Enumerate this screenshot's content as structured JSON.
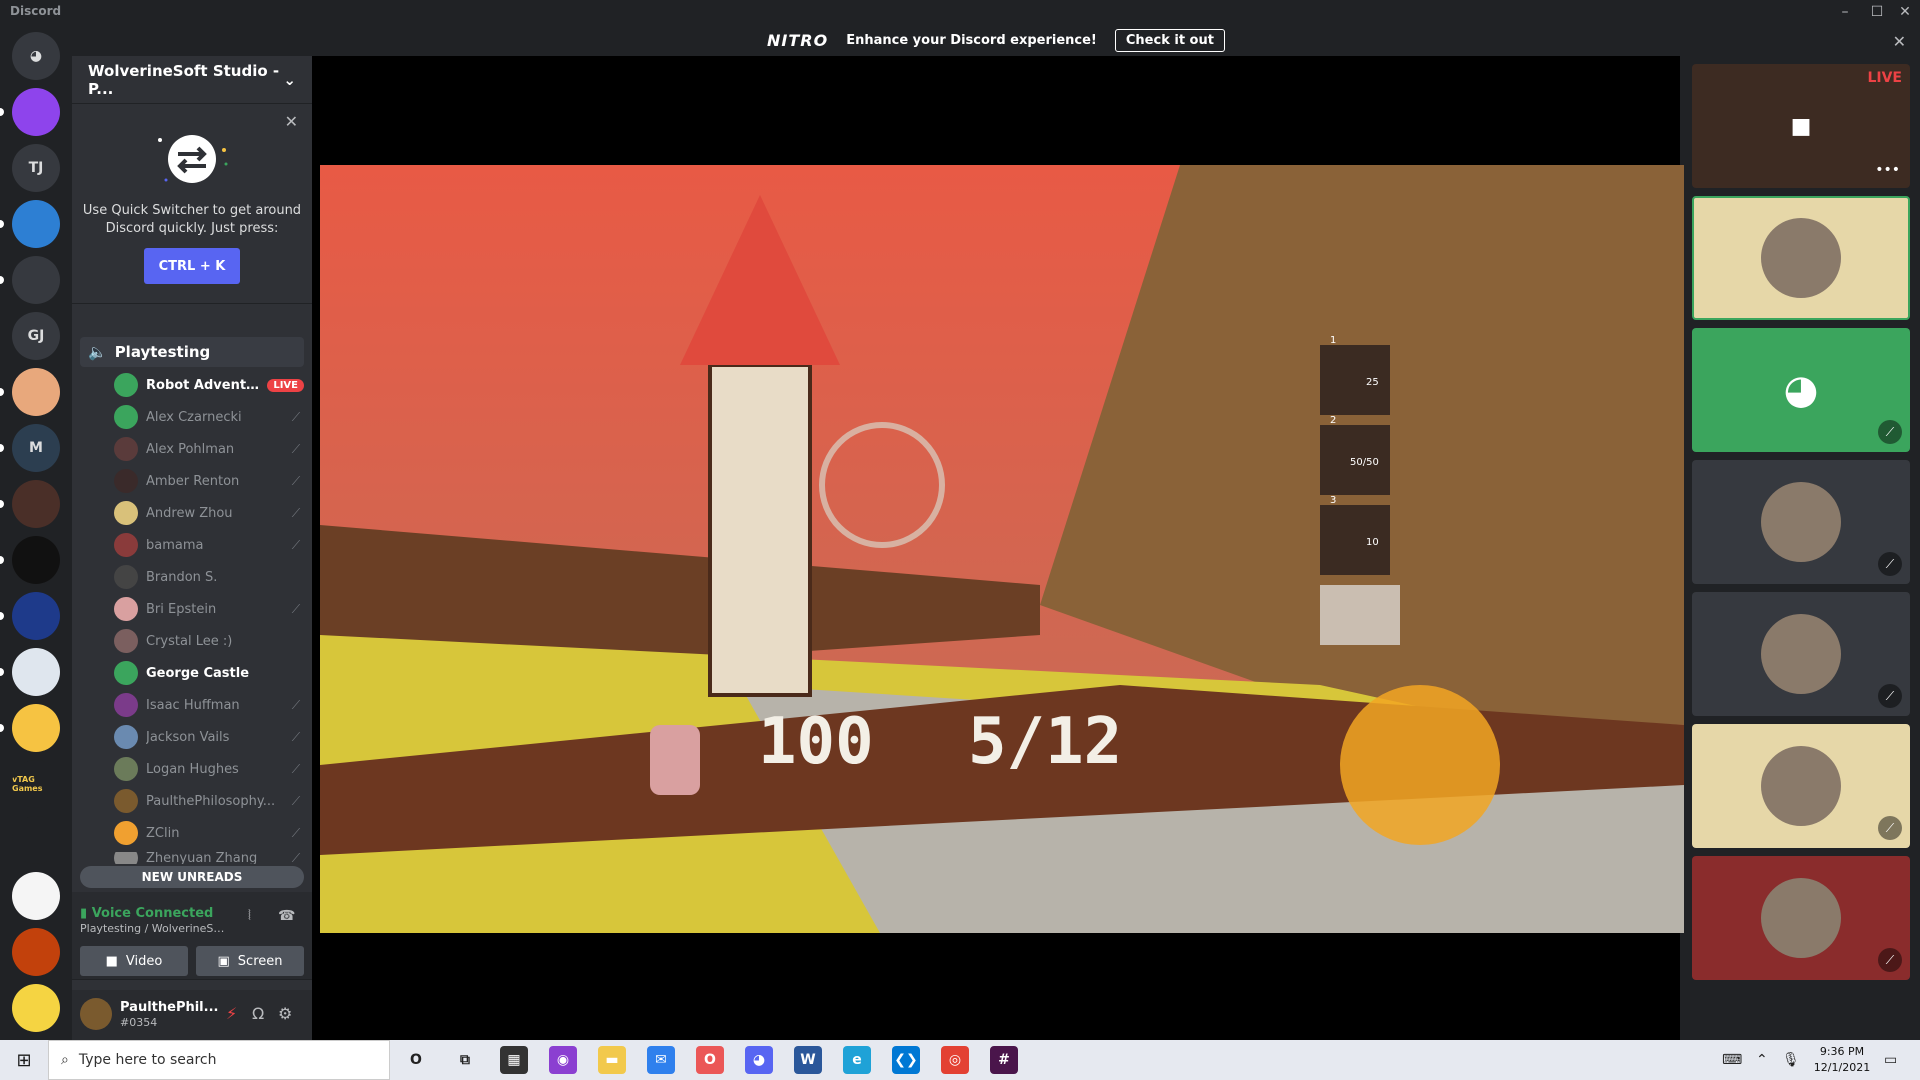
{
  "window": {
    "app_name": "Discord"
  },
  "nitro": {
    "logo": "NITRO",
    "message": "Enhance your Discord experience!",
    "cta": "Check it out"
  },
  "servers": [
    {
      "name": "Home",
      "label": "",
      "color": "#36393f"
    },
    {
      "name": "Server purple",
      "label": "",
      "color": "#8e44ec"
    },
    {
      "name": "TJ",
      "label": "TJ",
      "color": "#36393f"
    },
    {
      "name": "Server blue gear",
      "label": "",
      "color": "#2d7fd3"
    },
    {
      "name": "Server controller",
      "label": "",
      "color": "#36393f"
    },
    {
      "name": "GJ",
      "label": "GJ",
      "color": "#36393f"
    },
    {
      "name": "Server jar",
      "label": "",
      "color": "#e8a87c"
    },
    {
      "name": "Server M",
      "label": "M",
      "color": "#2c3e50"
    },
    {
      "name": "Server bloom",
      "label": "",
      "color": "#4a2f28"
    },
    {
      "name": "Server colorful",
      "label": "",
      "color": "#111111"
    },
    {
      "name": "Server animation",
      "label": "",
      "color": "#1e3a8a"
    },
    {
      "name": "Server wolverine 1",
      "label": "",
      "color": "#dfe6ee"
    },
    {
      "name": "Server wolverine 2",
      "label": "",
      "color": "#f6c342"
    },
    {
      "name": "Server tag",
      "label": "vTAG Games",
      "color": "#202225"
    },
    {
      "name": "Server chess",
      "label": "",
      "color": "#202225"
    },
    {
      "name": "Server hand",
      "label": "",
      "color": "#f5f5f5"
    },
    {
      "name": "Server circle orange",
      "label": "",
      "color": "#c2410c"
    },
    {
      "name": "Server pikachu",
      "label": "",
      "color": "#f5d442"
    }
  ],
  "guild": {
    "name": "WolverineSoft Studio - P..."
  },
  "quick_switcher": {
    "tip": "Use Quick Switcher to get around Discord quickly. Just press:",
    "shortcut": "CTRL + K"
  },
  "voice_channel": {
    "name": "Playtesting"
  },
  "members": [
    {
      "name": "Robot Adventure",
      "live": "LIVE",
      "active": true,
      "color": "#3ba55d"
    },
    {
      "name": "Alex Czarnecki",
      "muted": true,
      "color": "#3ba55d"
    },
    {
      "name": "Alex Pohlman",
      "muted": true,
      "color": "#5a3b3b"
    },
    {
      "name": "Amber Renton",
      "muted": true,
      "color": "#3a2a2a"
    },
    {
      "name": "Andrew Zhou",
      "muted": true,
      "color": "#d9c17a"
    },
    {
      "name": "bamama",
      "muted": true,
      "color": "#8a3b3b"
    },
    {
      "name": "Brandon S.",
      "muted": false,
      "color": "#444444"
    },
    {
      "name": "Bri Epstein",
      "muted": true,
      "color": "#d9a0a0"
    },
    {
      "name": "Crystal Lee :)",
      "muted": false,
      "color": "#7b5f5f"
    },
    {
      "name": "George Castle",
      "muted": false,
      "active": true,
      "color": "#3ba55d"
    },
    {
      "name": "Isaac Huffman",
      "muted": true,
      "color": "#7b3b8a"
    },
    {
      "name": "Jackson Vails",
      "muted": true,
      "color": "#6a8ab0"
    },
    {
      "name": "Logan Hughes",
      "muted": true,
      "color": "#6b7b5a"
    },
    {
      "name": "PaulthePhilosophy...",
      "muted": true,
      "color": "#7a5a2e"
    },
    {
      "name": "ZClin",
      "muted": true,
      "color": "#f0a030"
    },
    {
      "name": "Zhenyuan Zhang",
      "muted": true,
      "color": "#888888"
    }
  ],
  "new_unreads": "NEW UNREADS",
  "voice_status": {
    "title": "Voice Connected",
    "subtitle": "Playtesting / WolverineSoft...",
    "video_label": "Video",
    "screen_label": "Screen"
  },
  "user": {
    "name": "PaulthePhil...",
    "tag": "#0354"
  },
  "stream": {
    "health": "100",
    "ammo": "5/12",
    "slots": [
      "1",
      "2",
      "3"
    ],
    "slot_values": [
      "25",
      "50/50",
      "10"
    ]
  },
  "tiles": [
    {
      "name": "Robot Adventure stream",
      "live": "LIVE",
      "color": "#3d2b22"
    },
    {
      "name": "George Castle",
      "color": "#e6d7a8",
      "border": "#3ba55d"
    },
    {
      "name": "Alex Czarnecki",
      "color": "#3ba55d",
      "discord": true
    },
    {
      "name": "Amber Renton",
      "color": "#36393f"
    },
    {
      "name": "Bri Epstein",
      "color": "#36393f"
    },
    {
      "name": "Andrew Zhou",
      "color": "#e6d7a8"
    },
    {
      "name": "bamama",
      "color": "#8a2c2c"
    }
  ],
  "taskbar": {
    "search_placeholder": "Type here to search",
    "time": "9:36 PM",
    "date": "12/1/2021",
    "apps": [
      {
        "name": "cortana-icon",
        "glyph": "O",
        "color": "#e6e9f0"
      },
      {
        "name": "task-view-icon",
        "glyph": "⧉",
        "color": "#e6e9f0"
      },
      {
        "name": "store-icon",
        "glyph": "▦",
        "color": "#333333"
      },
      {
        "name": "podcast-icon",
        "glyph": "◉",
        "color": "#8b3fd1"
      },
      {
        "name": "file-explorer-icon",
        "glyph": "▬",
        "color": "#f2c94c"
      },
      {
        "name": "mail-icon",
        "glyph": "✉",
        "color": "#2f80ed"
      },
      {
        "name": "office-icon",
        "glyph": "O",
        "color": "#eb5757"
      },
      {
        "name": "discord-icon",
        "glyph": "◕",
        "color": "#5865f2"
      },
      {
        "name": "word-icon",
        "glyph": "W",
        "color": "#2b579a"
      },
      {
        "name": "edge-icon",
        "glyph": "e",
        "color": "#1fa2d7"
      },
      {
        "name": "vscode-icon",
        "glyph": "❮❯",
        "color": "#0078d4"
      },
      {
        "name": "chrome-icon",
        "glyph": "◎",
        "color": "#e34133"
      },
      {
        "name": "slack-icon",
        "glyph": "#",
        "color": "#4a154b"
      }
    ]
  },
  "colors": {
    "discord_bg": "#202225",
    "sidebar": "#2f3136",
    "accent": "#5865f2",
    "green": "#3ba55d",
    "red": "#ed4245"
  }
}
